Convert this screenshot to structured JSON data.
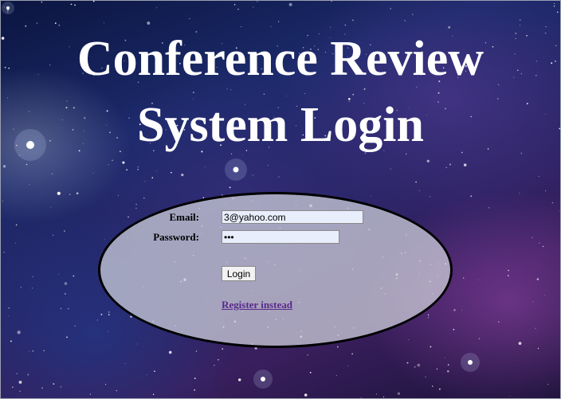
{
  "page": {
    "title_line1": "Conference Review",
    "title_line2": "System Login"
  },
  "form": {
    "email_label": "Email:",
    "email_value": "3@yahoo.com",
    "password_label": "Password:",
    "password_value": "***",
    "login_label": "Login",
    "register_link": "Register instead"
  },
  "colors": {
    "title": "#ffffff",
    "oval_border": "#000000",
    "link": "#5a2a8a"
  }
}
